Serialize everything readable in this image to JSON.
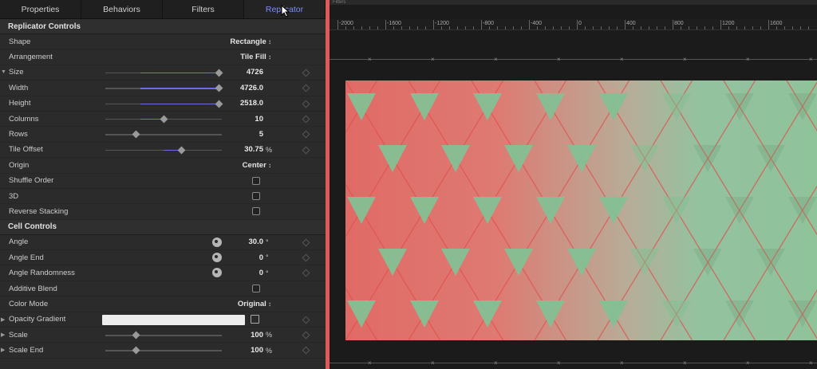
{
  "tabs": [
    {
      "label": "Properties",
      "active": false
    },
    {
      "label": "Behaviors",
      "active": false
    },
    {
      "label": "Filters",
      "active": false
    },
    {
      "label": "Replicator",
      "active": true
    }
  ],
  "sections": {
    "replicator": "Replicator Controls",
    "cell": "Cell Controls"
  },
  "rows": {
    "shape": {
      "label": "Shape",
      "value": "Rectangle"
    },
    "arrangement": {
      "label": "Arrangement",
      "value": "Tile Fill"
    },
    "size": {
      "label": "Size",
      "value": "4726",
      "level": 0.97
    },
    "width": {
      "label": "Width",
      "value": "4726.0",
      "level": 0.97
    },
    "height": {
      "label": "Height",
      "value": "2518.0",
      "level": 0.97
    },
    "columns": {
      "label": "Columns",
      "value": "10",
      "level": 0.5
    },
    "rows": {
      "label": "Rows",
      "value": "5",
      "level": 0.26
    },
    "tile_offset": {
      "label": "Tile Offset",
      "value": "30.75",
      "unit": "%",
      "level": 0.65
    },
    "origin": {
      "label": "Origin",
      "value": "Center"
    },
    "shuffle": {
      "label": "Shuffle Order"
    },
    "three_d": {
      "label": "3D"
    },
    "reverse": {
      "label": "Reverse Stacking"
    },
    "angle": {
      "label": "Angle",
      "value": "30.0",
      "unit": "°"
    },
    "angle_end": {
      "label": "Angle End",
      "value": "0",
      "unit": "°"
    },
    "angle_rand": {
      "label": "Angle Randomness",
      "value": "0",
      "unit": "°"
    },
    "additive": {
      "label": "Additive Blend"
    },
    "color_mode": {
      "label": "Color Mode",
      "value": "Original"
    },
    "opacity_grad": {
      "label": "Opacity Gradient"
    },
    "scale": {
      "label": "Scale",
      "value": "100",
      "unit": "%",
      "level": 0.26
    },
    "scale_end": {
      "label": "Scale End",
      "value": "100",
      "unit": "%",
      "level": 0.26
    }
  },
  "viewer": {
    "top_label": "Filters",
    "ruler_ticks": [
      "-2000",
      "-1600",
      "-1200",
      "-800",
      "-400",
      "0",
      "400",
      "800",
      "1200",
      "1600"
    ]
  },
  "colors": {
    "accent": "#7b8dff",
    "red": "#e06a66",
    "green": "#8fc39a"
  }
}
